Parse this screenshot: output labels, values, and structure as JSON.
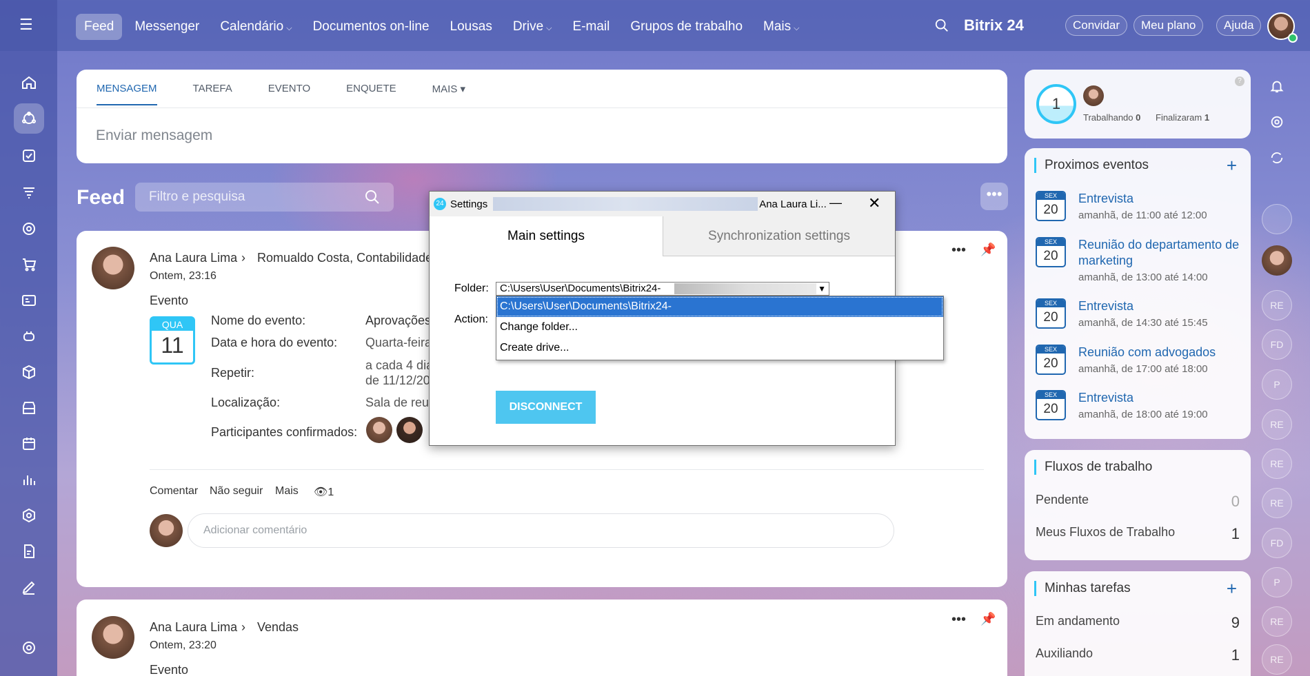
{
  "topnav": {
    "items": [
      "Feed",
      "Messenger",
      "Calendário",
      "Documentos on-line",
      "Lousas",
      "Drive",
      "E-mail",
      "Grupos de trabalho",
      "Mais"
    ],
    "logo": "Bitrix 24",
    "invite": "Convidar",
    "plan": "Meu plano",
    "help": "Ajuda"
  },
  "post": {
    "tabs": [
      "MENSAGEM",
      "TAREFA",
      "EVENTO",
      "ENQUETE",
      "MAIS"
    ],
    "placeholder": "Enviar mensagem"
  },
  "feed": {
    "title": "Feed",
    "filter_placeholder": "Filtro e pesquisa"
  },
  "entry1": {
    "author": "Ana Laura Lima",
    "recipients": "Romualdo Costa, Contabilidade",
    "time": "Ontem, 23:16",
    "type": "Evento",
    "cal_month": "QUA",
    "cal_day": "11",
    "f_name": "Nome do evento:",
    "v_name": "Aprovações",
    "f_date": "Data e hora do evento:",
    "v_date": "Quarta-feira",
    "f_repeat": "Repetir:",
    "v_repeat1": "a cada 4 dia",
    "v_repeat2": "de 11/12/20",
    "f_loc": "Localização:",
    "v_loc": "Sala de reun",
    "f_part": "Participantes confirmados:",
    "comment": "Comentar",
    "unfollow": "Não seguir",
    "more": "Mais",
    "views": "1",
    "add_comment": "Adicionar comentário"
  },
  "entry2": {
    "author": "Ana Laura Lima",
    "recipients": "Vendas",
    "time": "Ontem, 23:20",
    "type": "Evento"
  },
  "dialog": {
    "title": "Settings",
    "user": "Ana Laura Li...",
    "tab_main": "Main settings",
    "tab_sync": "Synchronization settings",
    "folder_label": "Folder:",
    "action_label": "Action:",
    "folder_value": "C:\\Users\\User\\Documents\\Bitrix24-",
    "options": [
      "C:\\Users\\User\\Documents\\Bitrix24-",
      "Change folder...",
      "Create drive..."
    ],
    "disconnect": "DISCONNECT"
  },
  "worktime": {
    "count": "1",
    "working_label": "Trabalhando",
    "working": "0",
    "finished_label": "Finalizaram",
    "finished": "1"
  },
  "events": {
    "title": "Proximos eventos",
    "items": [
      {
        "m": "SEX",
        "d": "20",
        "title": "Entrevista",
        "time": "amanhã, de 11:00 até 12:00"
      },
      {
        "m": "SEX",
        "d": "20",
        "title": "Reunião do departamento de marketing",
        "time": "amanhã, de 13:00 até 14:00"
      },
      {
        "m": "SEX",
        "d": "20",
        "title": "Entrevista",
        "time": "amanhã, de 14:30 até 15:45"
      },
      {
        "m": "SEX",
        "d": "20",
        "title": "Reunião com advogados",
        "time": "amanhã, de 17:00 até 18:00"
      },
      {
        "m": "SEX",
        "d": "20",
        "title": "Entrevista",
        "time": "amanhã, de 18:00 até 19:00"
      }
    ]
  },
  "flows": {
    "title": "Fluxos de trabalho",
    "pending": "Pendente",
    "pending_n": "0",
    "mine": "Meus Fluxos de Trabalho",
    "mine_n": "1"
  },
  "tasks": {
    "title": "Minhas tarefas",
    "progress": "Em andamento",
    "progress_n": "9",
    "helping": "Auxiliando",
    "helping_n": "1"
  },
  "strip": [
    "RE",
    "FD",
    "P",
    "RE",
    "RE",
    "RE",
    "FD",
    "P",
    "RE",
    "RE"
  ]
}
